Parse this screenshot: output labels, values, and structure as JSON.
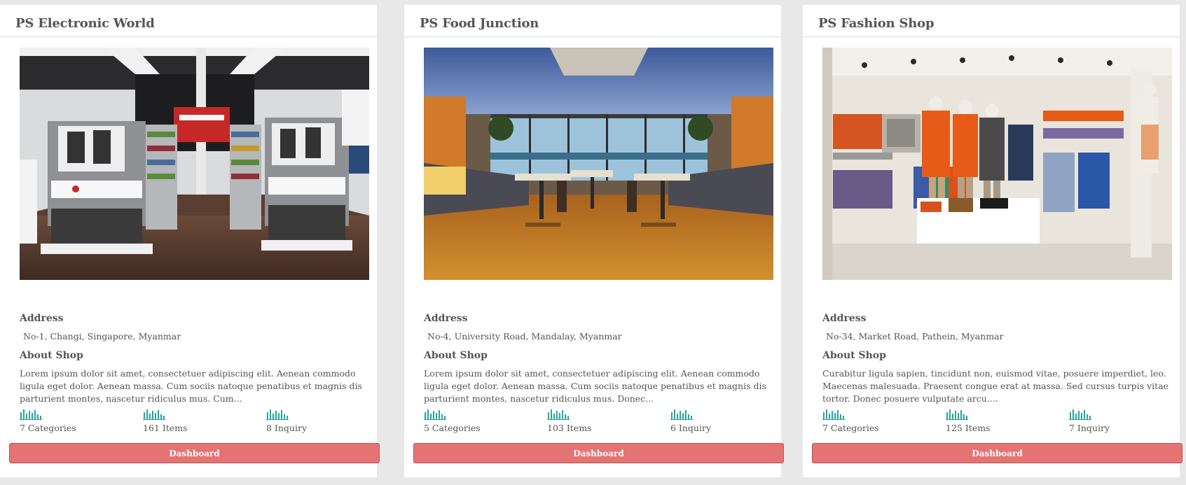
{
  "labels": {
    "address": "Address",
    "about": "About Shop",
    "dashboard": "Dashboard"
  },
  "accent_color": "#26a69a",
  "button_color": "#e57373",
  "shops": [
    {
      "name": "PS Electronic World",
      "image": "electronics-store-photo",
      "address": "No-1, Changi, Singapore, Myanmar",
      "about": "Lorem ipsum dolor sit amet, consectetuer adipiscing elit. Aenean commodo ligula eget dolor. Aenean massa. Cum sociis natoque penatibus et magnis dis parturient montes, nascetur ridiculus mus. Cum...",
      "categories": "7 Categories",
      "items": "161 Items",
      "inquiry": "8 Inquiry"
    },
    {
      "name": "PS Food Junction",
      "image": "restaurant-interior-photo",
      "address": "No-4, University Road, Mandalay, Myanmar",
      "about": "Lorem ipsum dolor sit amet, consectetuer adipiscing elit. Aenean commodo ligula eget dolor. Aenean massa. Cum sociis natoque penatibus et magnis dis parturient montes, nascetur ridiculus mus. Donec...",
      "categories": "5 Categories",
      "items": "103 Items",
      "inquiry": "6 Inquiry"
    },
    {
      "name": "PS Fashion Shop",
      "image": "clothing-store-photo",
      "address": "No-34, Market Road, Pathein, Myanmar",
      "about": "Curabitur ligula sapien, tincidunt non, euismod vitae, posuere imperdiet, leo. Maecenas malesuada. Praesent congue erat at massa. Sed cursus turpis vitae tortor. Donec posuere vulputate arcu....",
      "categories": "7 Categories",
      "items": "125 Items",
      "inquiry": "7 Inquiry"
    }
  ]
}
